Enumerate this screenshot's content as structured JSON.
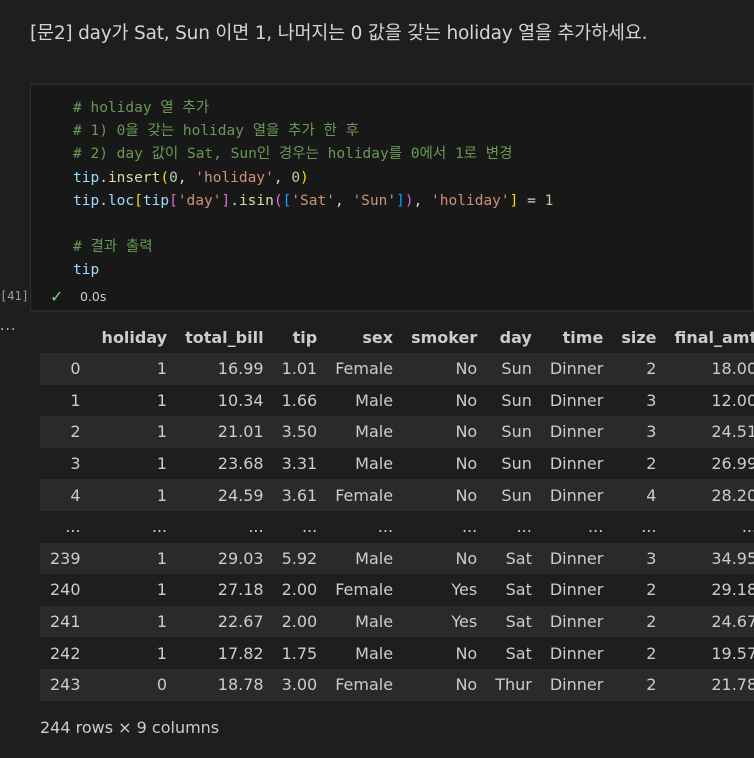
{
  "heading": "[문2] day가 Sat, Sun 이면 1, 나머지는 0 값을 갖는 holiday 열을 추가하세요.",
  "cell": {
    "exec_count": "[41]",
    "status_icon": "check-icon",
    "status_time": "0.0s",
    "code": {
      "comment1": "# holiday 열 추가",
      "comment2": "# 1) 0을 갖는 holiday 열을 추가 한 후",
      "comment3": "# 2) day 값이 Sat, Sun인 경우는 holiday를 0에서 1로 변경",
      "comment4": "# 결과 출력",
      "last_line": "tip"
    }
  },
  "output": {
    "dots": "...",
    "columns": [
      "",
      "holiday",
      "total_bill",
      "tip",
      "sex",
      "smoker",
      "day",
      "time",
      "size",
      "final_amt"
    ],
    "rows": [
      [
        "0",
        "1",
        "16.99",
        "1.01",
        "Female",
        "No",
        "Sun",
        "Dinner",
        "2",
        "18.00"
      ],
      [
        "1",
        "1",
        "10.34",
        "1.66",
        "Male",
        "No",
        "Sun",
        "Dinner",
        "3",
        "12.00"
      ],
      [
        "2",
        "1",
        "21.01",
        "3.50",
        "Male",
        "No",
        "Sun",
        "Dinner",
        "3",
        "24.51"
      ],
      [
        "3",
        "1",
        "23.68",
        "3.31",
        "Male",
        "No",
        "Sun",
        "Dinner",
        "2",
        "26.99"
      ],
      [
        "4",
        "1",
        "24.59",
        "3.61",
        "Female",
        "No",
        "Sun",
        "Dinner",
        "4",
        "28.20"
      ],
      [
        "...",
        "...",
        "...",
        "...",
        "...",
        "...",
        "...",
        "...",
        "...",
        "..."
      ],
      [
        "239",
        "1",
        "29.03",
        "5.92",
        "Male",
        "No",
        "Sat",
        "Dinner",
        "3",
        "34.95"
      ],
      [
        "240",
        "1",
        "27.18",
        "2.00",
        "Female",
        "Yes",
        "Sat",
        "Dinner",
        "2",
        "29.18"
      ],
      [
        "241",
        "1",
        "22.67",
        "2.00",
        "Male",
        "Yes",
        "Sat",
        "Dinner",
        "2",
        "24.67"
      ],
      [
        "242",
        "1",
        "17.82",
        "1.75",
        "Male",
        "No",
        "Sat",
        "Dinner",
        "2",
        "19.57"
      ],
      [
        "243",
        "0",
        "18.78",
        "3.00",
        "Female",
        "No",
        "Thur",
        "Dinner",
        "2",
        "21.78"
      ]
    ],
    "footer": "244 rows × 9 columns"
  },
  "colors": {
    "background": "#1e1e1e",
    "editor_bg": "#181818",
    "comment": "#6a9955",
    "variable": "#9cdcfe",
    "function": "#dcdcaa",
    "string": "#ce9178",
    "number": "#b5cea8",
    "success": "#89d185"
  }
}
